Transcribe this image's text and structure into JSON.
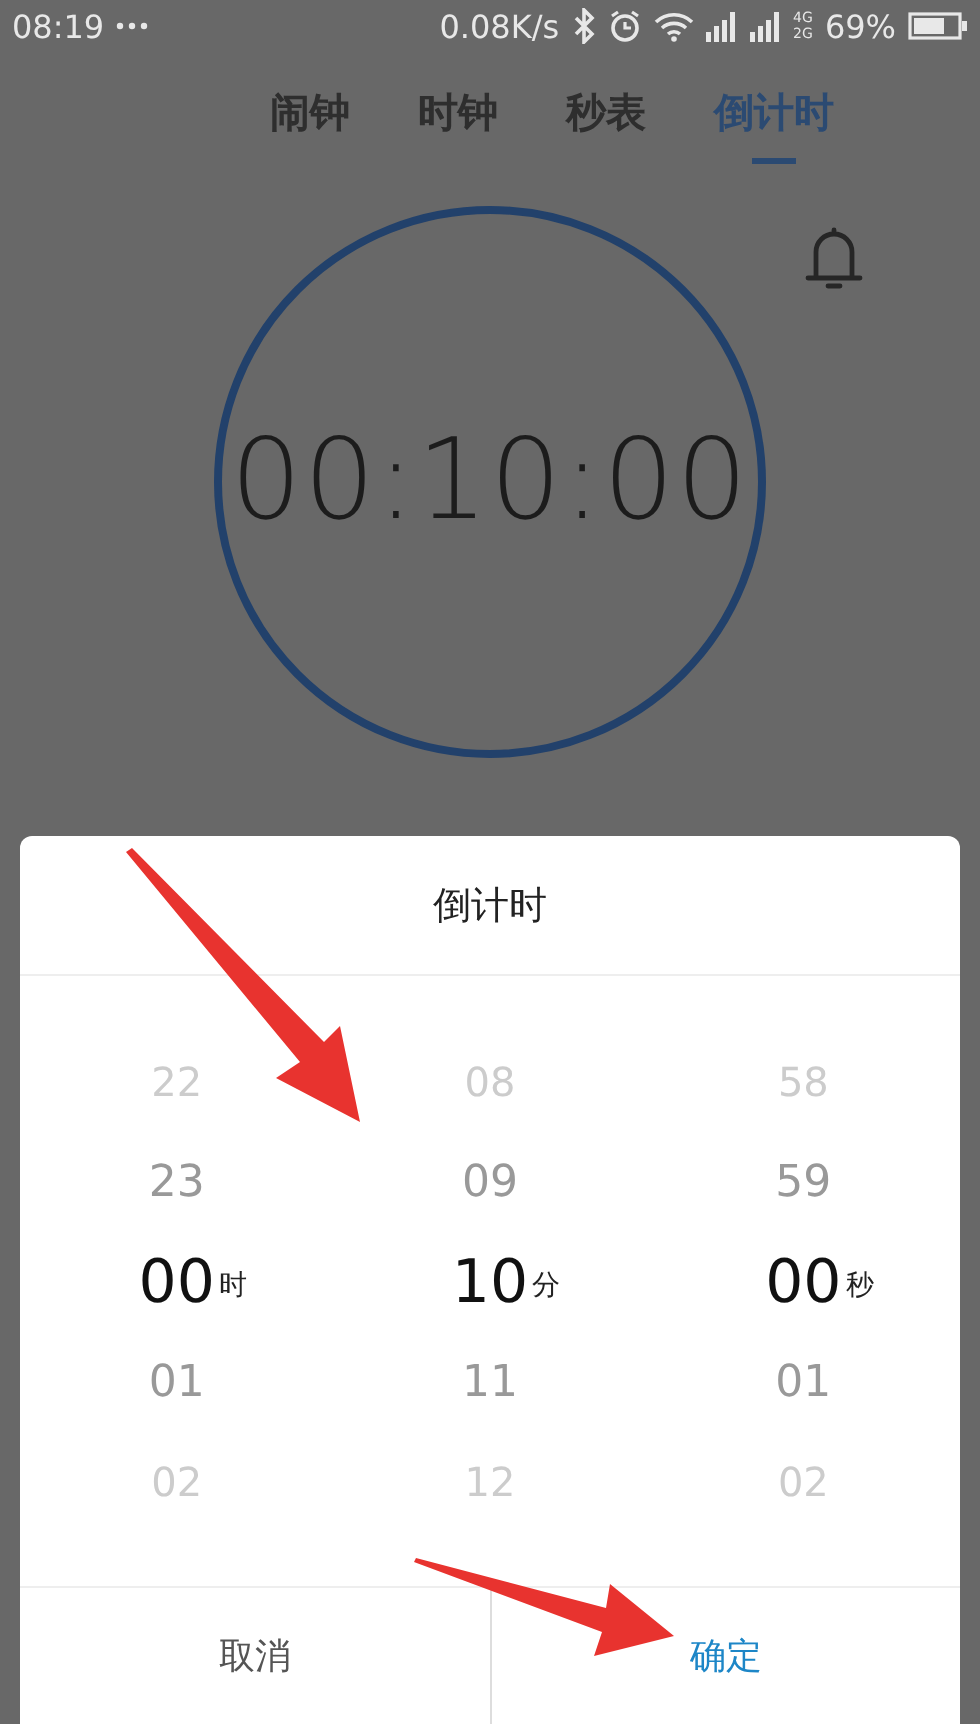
{
  "status_bar": {
    "time": "08:19",
    "speed": "0.08K/s",
    "network_top": "4G",
    "network_bottom": "2G",
    "battery": "69%"
  },
  "tabs": [
    {
      "label": "闹钟",
      "selected": false
    },
    {
      "label": "时钟",
      "selected": false
    },
    {
      "label": "秒表",
      "selected": false
    },
    {
      "label": "倒计时",
      "selected": true
    }
  ],
  "timer": {
    "display": "00:10:00"
  },
  "dialog": {
    "title": "倒计时",
    "pickers": [
      {
        "unit": "时",
        "items": [
          {
            "value": "22",
            "selected": false
          },
          {
            "value": "23",
            "selected": false
          },
          {
            "value": "00",
            "selected": true
          },
          {
            "value": "01",
            "selected": false
          },
          {
            "value": "02",
            "selected": false
          }
        ]
      },
      {
        "unit": "分",
        "items": [
          {
            "value": "08",
            "selected": false
          },
          {
            "value": "09",
            "selected": false
          },
          {
            "value": "10",
            "selected": true
          },
          {
            "value": "11",
            "selected": false
          },
          {
            "value": "12",
            "selected": false
          }
        ]
      },
      {
        "unit": "秒",
        "items": [
          {
            "value": "58",
            "selected": false
          },
          {
            "value": "59",
            "selected": false
          },
          {
            "value": "00",
            "selected": true
          },
          {
            "value": "01",
            "selected": false
          },
          {
            "value": "02",
            "selected": false
          }
        ]
      }
    ],
    "buttons": [
      {
        "label": "取消",
        "kind": "cancel"
      },
      {
        "label": "确定",
        "kind": "confirm"
      }
    ]
  }
}
